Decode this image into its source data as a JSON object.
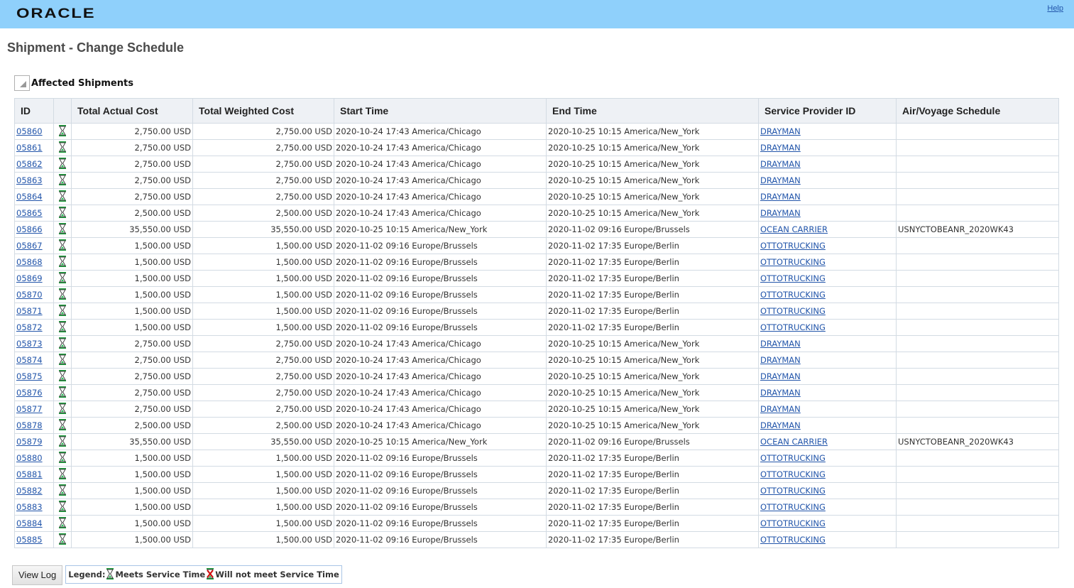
{
  "header": {
    "logo": "ORACLE",
    "help": "Help"
  },
  "page_title": "Shipment - Change Schedule",
  "section_title": "Affected Shipments",
  "columns": [
    "ID",
    "",
    "Total Actual Cost",
    "Total Weighted Cost",
    "Start Time",
    "End Time",
    "Service Provider ID",
    "Air/Voyage Schedule"
  ],
  "rows": [
    [
      "05860",
      "2,750.00 USD",
      "2,750.00 USD",
      "2020-10-24 17:43 America/Chicago",
      "2020-10-25 10:15 America/New_York",
      "DRAYMAN",
      ""
    ],
    [
      "05861",
      "2,750.00 USD",
      "2,750.00 USD",
      "2020-10-24 17:43 America/Chicago",
      "2020-10-25 10:15 America/New_York",
      "DRAYMAN",
      ""
    ],
    [
      "05862",
      "2,750.00 USD",
      "2,750.00 USD",
      "2020-10-24 17:43 America/Chicago",
      "2020-10-25 10:15 America/New_York",
      "DRAYMAN",
      ""
    ],
    [
      "05863",
      "2,750.00 USD",
      "2,750.00 USD",
      "2020-10-24 17:43 America/Chicago",
      "2020-10-25 10:15 America/New_York",
      "DRAYMAN",
      ""
    ],
    [
      "05864",
      "2,750.00 USD",
      "2,750.00 USD",
      "2020-10-24 17:43 America/Chicago",
      "2020-10-25 10:15 America/New_York",
      "DRAYMAN",
      ""
    ],
    [
      "05865",
      "2,500.00 USD",
      "2,500.00 USD",
      "2020-10-24 17:43 America/Chicago",
      "2020-10-25 10:15 America/New_York",
      "DRAYMAN",
      ""
    ],
    [
      "05866",
      "35,550.00 USD",
      "35,550.00 USD",
      "2020-10-25 10:15 America/New_York",
      "2020-11-02 09:16 Europe/Brussels",
      "OCEAN CARRIER",
      "USNYCTOBEANR_2020WK43"
    ],
    [
      "05867",
      "1,500.00 USD",
      "1,500.00 USD",
      "2020-11-02 09:16 Europe/Brussels",
      "2020-11-02 17:35 Europe/Berlin",
      "OTTOTRUCKING",
      ""
    ],
    [
      "05868",
      "1,500.00 USD",
      "1,500.00 USD",
      "2020-11-02 09:16 Europe/Brussels",
      "2020-11-02 17:35 Europe/Berlin",
      "OTTOTRUCKING",
      ""
    ],
    [
      "05869",
      "1,500.00 USD",
      "1,500.00 USD",
      "2020-11-02 09:16 Europe/Brussels",
      "2020-11-02 17:35 Europe/Berlin",
      "OTTOTRUCKING",
      ""
    ],
    [
      "05870",
      "1,500.00 USD",
      "1,500.00 USD",
      "2020-11-02 09:16 Europe/Brussels",
      "2020-11-02 17:35 Europe/Berlin",
      "OTTOTRUCKING",
      ""
    ],
    [
      "05871",
      "1,500.00 USD",
      "1,500.00 USD",
      "2020-11-02 09:16 Europe/Brussels",
      "2020-11-02 17:35 Europe/Berlin",
      "OTTOTRUCKING",
      ""
    ],
    [
      "05872",
      "1,500.00 USD",
      "1,500.00 USD",
      "2020-11-02 09:16 Europe/Brussels",
      "2020-11-02 17:35 Europe/Berlin",
      "OTTOTRUCKING",
      ""
    ],
    [
      "05873",
      "2,750.00 USD",
      "2,750.00 USD",
      "2020-10-24 17:43 America/Chicago",
      "2020-10-25 10:15 America/New_York",
      "DRAYMAN",
      ""
    ],
    [
      "05874",
      "2,750.00 USD",
      "2,750.00 USD",
      "2020-10-24 17:43 America/Chicago",
      "2020-10-25 10:15 America/New_York",
      "DRAYMAN",
      ""
    ],
    [
      "05875",
      "2,750.00 USD",
      "2,750.00 USD",
      "2020-10-24 17:43 America/Chicago",
      "2020-10-25 10:15 America/New_York",
      "DRAYMAN",
      ""
    ],
    [
      "05876",
      "2,750.00 USD",
      "2,750.00 USD",
      "2020-10-24 17:43 America/Chicago",
      "2020-10-25 10:15 America/New_York",
      "DRAYMAN",
      ""
    ],
    [
      "05877",
      "2,750.00 USD",
      "2,750.00 USD",
      "2020-10-24 17:43 America/Chicago",
      "2020-10-25 10:15 America/New_York",
      "DRAYMAN",
      ""
    ],
    [
      "05878",
      "2,500.00 USD",
      "2,500.00 USD",
      "2020-10-24 17:43 America/Chicago",
      "2020-10-25 10:15 America/New_York",
      "DRAYMAN",
      ""
    ],
    [
      "05879",
      "35,550.00 USD",
      "35,550.00 USD",
      "2020-10-25 10:15 America/New_York",
      "2020-11-02 09:16 Europe/Brussels",
      "OCEAN CARRIER",
      "USNYCTOBEANR_2020WK43"
    ],
    [
      "05880",
      "1,500.00 USD",
      "1,500.00 USD",
      "2020-11-02 09:16 Europe/Brussels",
      "2020-11-02 17:35 Europe/Berlin",
      "OTTOTRUCKING",
      ""
    ],
    [
      "05881",
      "1,500.00 USD",
      "1,500.00 USD",
      "2020-11-02 09:16 Europe/Brussels",
      "2020-11-02 17:35 Europe/Berlin",
      "OTTOTRUCKING",
      ""
    ],
    [
      "05882",
      "1,500.00 USD",
      "1,500.00 USD",
      "2020-11-02 09:16 Europe/Brussels",
      "2020-11-02 17:35 Europe/Berlin",
      "OTTOTRUCKING",
      ""
    ],
    [
      "05883",
      "1,500.00 USD",
      "1,500.00 USD",
      "2020-11-02 09:16 Europe/Brussels",
      "2020-11-02 17:35 Europe/Berlin",
      "OTTOTRUCKING",
      ""
    ],
    [
      "05884",
      "1,500.00 USD",
      "1,500.00 USD",
      "2020-11-02 09:16 Europe/Brussels",
      "2020-11-02 17:35 Europe/Berlin",
      "OTTOTRUCKING",
      ""
    ],
    [
      "05885",
      "1,500.00 USD",
      "1,500.00 USD",
      "2020-11-02 09:16 Europe/Brussels",
      "2020-11-02 17:35 Europe/Berlin",
      "OTTOTRUCKING",
      ""
    ]
  ],
  "footer": {
    "view_log": "View Log",
    "legend_label": "Legend:",
    "meets": "Meets Service Time",
    "not_meet": "Will not meet Service Time"
  }
}
